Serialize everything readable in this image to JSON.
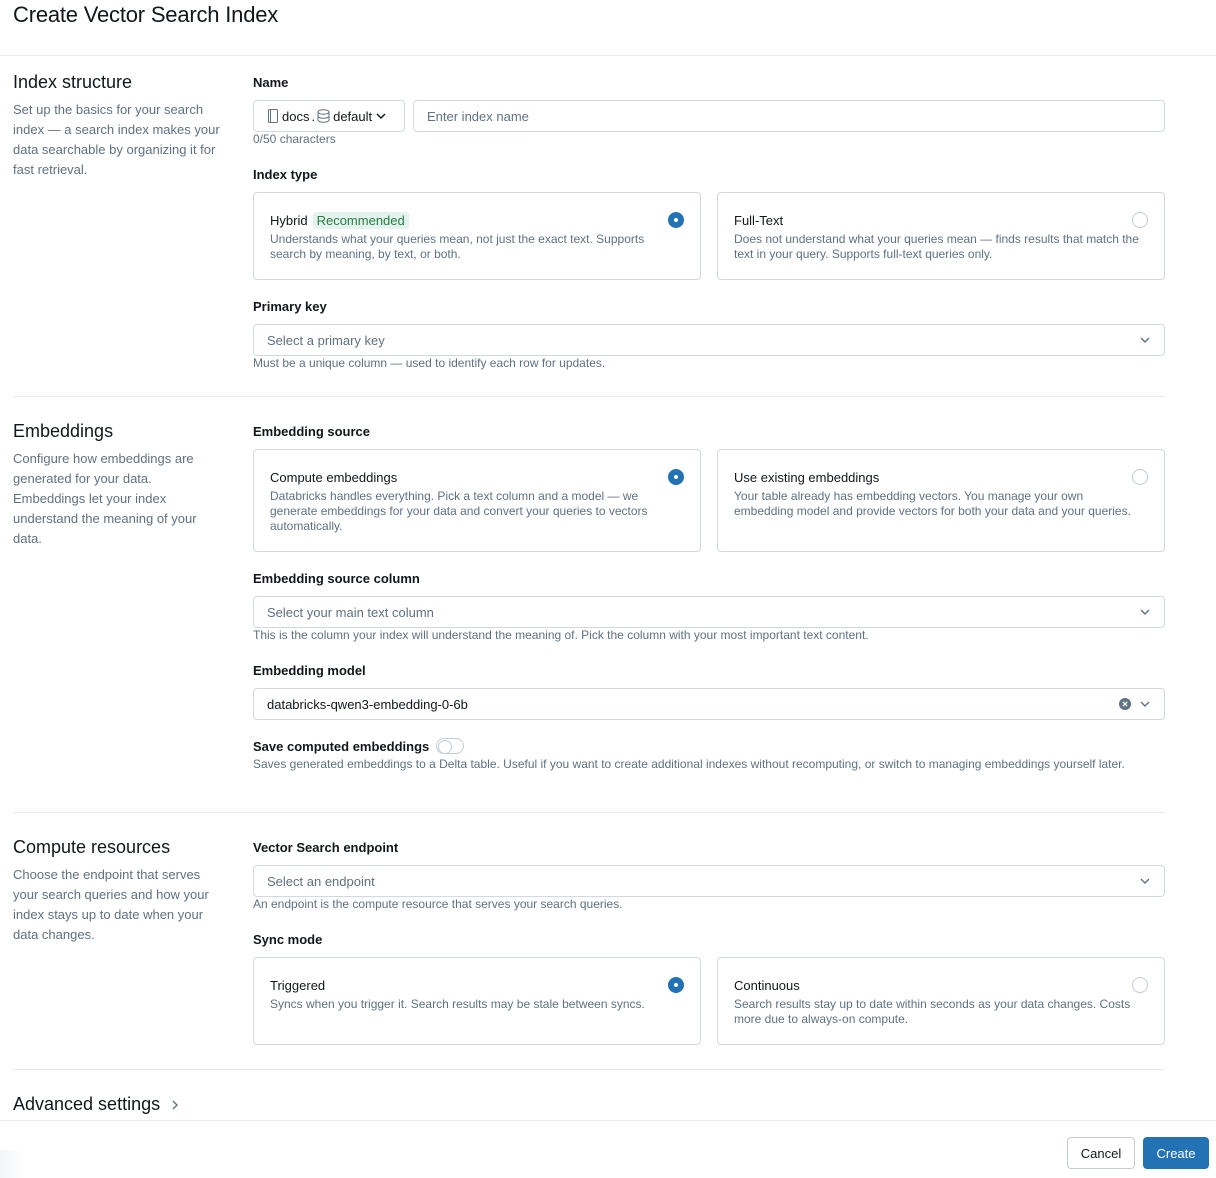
{
  "page": {
    "title": "Create Vector Search Index"
  },
  "sections": {
    "index_structure": {
      "title": "Index structure",
      "description": "Set up the basics for your search index — a search index makes your data searchable by organizing it for fast retrieval."
    },
    "embeddings": {
      "title": "Embeddings",
      "description": "Configure how embeddings are generated for your data. Embeddings let your index understand the meaning of your data."
    },
    "compute": {
      "title": "Compute resources",
      "description": "Choose the endpoint that serves your search queries and how your index stays up to date when your data changes."
    }
  },
  "name_field": {
    "label": "Name",
    "catalog": "docs",
    "separator": ".",
    "schema": "default",
    "placeholder": "Enter index name",
    "value": "",
    "char_count": "0/50 characters"
  },
  "index_type": {
    "label": "Index type",
    "options": [
      {
        "title": "Hybrid",
        "badge": "Recommended",
        "description": "Understands what your queries mean, not just the exact text. Supports search by meaning, by text, or both.",
        "selected": true
      },
      {
        "title": "Full-Text",
        "description": "Does not understand what your queries mean — finds results that match the text in your query. Supports full-text queries only.",
        "selected": false
      }
    ]
  },
  "primary_key": {
    "label": "Primary key",
    "placeholder": "Select a primary key",
    "hint": "Must be a unique column — used to identify each row for updates."
  },
  "embedding_source": {
    "label": "Embedding source",
    "options": [
      {
        "title": "Compute embeddings",
        "description": "Databricks handles everything. Pick a text column and a model — we generate embeddings for your data and convert your queries to vectors automatically.",
        "selected": true
      },
      {
        "title": "Use existing embeddings",
        "description": "Your table already has embedding vectors. You manage your own embedding model and provide vectors for both your data and your queries.",
        "selected": false
      }
    ]
  },
  "embedding_source_column": {
    "label": "Embedding source column",
    "placeholder": "Select your main text column",
    "hint": "This is the column your index will understand the meaning of. Pick the column with your most important text content."
  },
  "embedding_model": {
    "label": "Embedding model",
    "value": "databricks-qwen3-embedding-0-6b"
  },
  "save_embeddings": {
    "label": "Save computed embeddings",
    "enabled": false,
    "description": "Saves generated embeddings to a Delta table. Useful if you want to create additional indexes without recomputing, or switch to managing embeddings yourself later."
  },
  "endpoint": {
    "label": "Vector Search endpoint",
    "placeholder": "Select an endpoint",
    "hint": "An endpoint is the compute resource that serves your search queries."
  },
  "sync_mode": {
    "label": "Sync mode",
    "options": [
      {
        "title": "Triggered",
        "description": "Syncs when you trigger it. Search results may be stale between syncs.",
        "selected": true
      },
      {
        "title": "Continuous",
        "description": "Search results stay up to date within seconds as your data changes. Costs more due to always-on compute.",
        "selected": false
      }
    ]
  },
  "advanced": {
    "title": "Advanced settings"
  },
  "footer": {
    "cancel_label": "Cancel",
    "create_label": "Create"
  },
  "colors": {
    "accent": "#2272b4",
    "badge_bg": "#e5f3ee",
    "badge_text": "#277c43",
    "border": "#d1d9e1",
    "muted_text": "#5f7281"
  }
}
